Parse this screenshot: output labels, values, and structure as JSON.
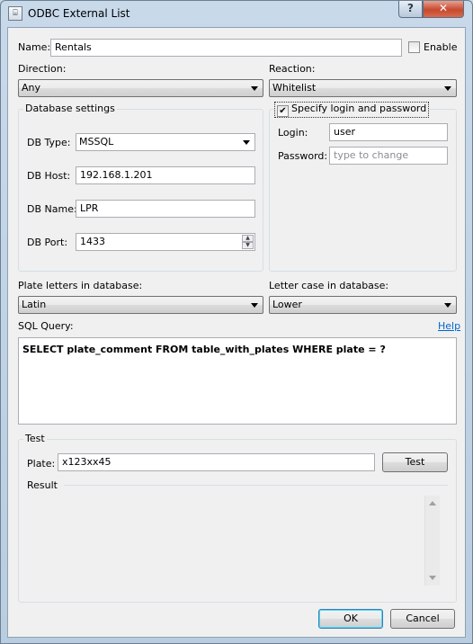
{
  "window": {
    "title": "ODBC External List",
    "help_button": "?",
    "close_button": "✕"
  },
  "name": {
    "label": "Name:",
    "value": "Rentals",
    "enable_label": "Enable",
    "enable_checked": false
  },
  "direction": {
    "label": "Direction:",
    "value": "Any"
  },
  "reaction": {
    "label": "Reaction:",
    "value": "Whitelist"
  },
  "db_settings": {
    "title": "Database settings",
    "type_label": "DB Type:",
    "type_value": "MSSQL",
    "host_label": "DB Host:",
    "host_value": "192.168.1.201",
    "name_label": "DB Name:",
    "name_value": "LPR",
    "port_label": "DB Port:",
    "port_value": "1433"
  },
  "login": {
    "checkbox_label": "Specify login and password",
    "checked": true,
    "login_label": "Login:",
    "login_value": "user",
    "password_label": "Password:",
    "password_placeholder": "type to change"
  },
  "plate_letters": {
    "label": "Plate letters in database:",
    "value": "Latin"
  },
  "letter_case": {
    "label": "Letter case in database:",
    "value": "Lower"
  },
  "sql": {
    "label": "SQL Query:",
    "help_link": "Help",
    "query": "SELECT plate_comment FROM table_with_plates WHERE plate = ?"
  },
  "test": {
    "title": "Test",
    "plate_label": "Plate:",
    "plate_value": "x123xx45",
    "test_button": "Test",
    "result_label": "Result"
  },
  "footer": {
    "ok_button": "OK",
    "cancel_button": "Cancel"
  }
}
